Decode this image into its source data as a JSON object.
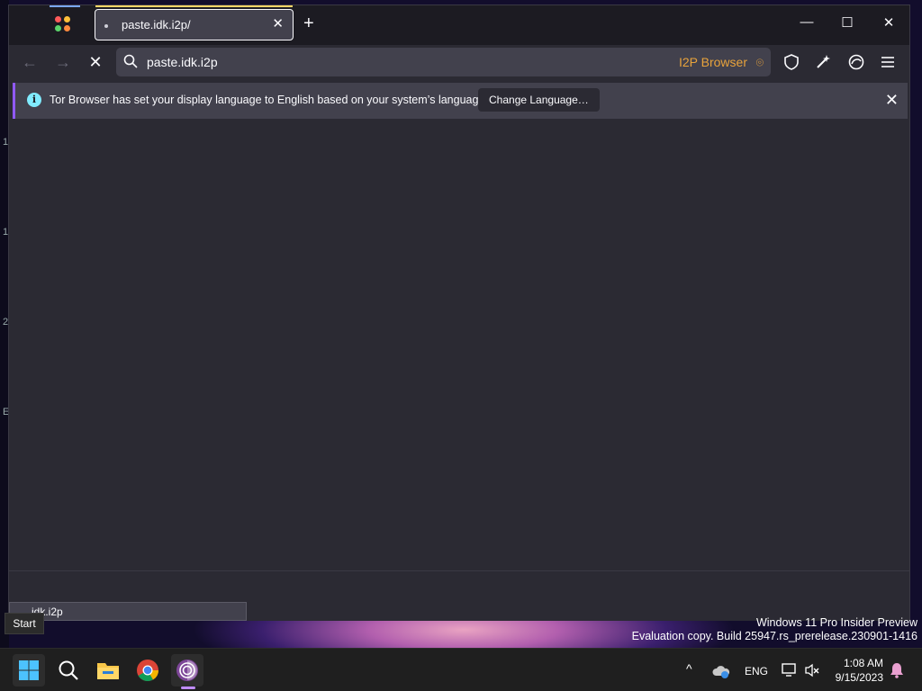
{
  "browser": {
    "tab": {
      "title": "paste.idk.i2p/",
      "close": "✕"
    },
    "new_tab": "+",
    "window_controls": {
      "minimize": "—",
      "maximize": "☐",
      "close": "✕"
    },
    "nav": {
      "back": "←",
      "forward": "→",
      "stop": "✕"
    },
    "urlbar": {
      "value": "paste.idk.i2p",
      "identity_label": "I2P Browser"
    },
    "toolbar_icons": [
      "shield-icon",
      "magic-wand-icon",
      "onion-circuit-icon",
      "menu-icon"
    ],
    "notification": {
      "text": "Tor Browser has set your display language to English based on your system’s language.",
      "button": "Change Language…",
      "close": "✕"
    },
    "status_url": "idk.i2p"
  },
  "desktop": {
    "start_tooltip": "Start",
    "watermark": {
      "line1": "Windows 11 Pro Insider Preview",
      "line2": "Evaluation copy. Build 25947.rs_prerelease.230901-1416"
    },
    "edge_glyphs": [
      "1",
      "1",
      "2",
      "E"
    ]
  },
  "taskbar": {
    "apps": [
      "windows-start-icon",
      "search-icon",
      "file-explorer-icon",
      "chrome-icon",
      "tor-browser-icon"
    ],
    "tray": {
      "chevron": "^",
      "language": "ENG"
    },
    "clock": {
      "time": "1:08 AM",
      "date": "9/15/2023"
    }
  },
  "colors": {
    "accent": "#9059ff",
    "i2p": "#e8a33c",
    "info": "#80ebff",
    "surface": "#2b2a33",
    "chrome": "#1c1b22"
  }
}
